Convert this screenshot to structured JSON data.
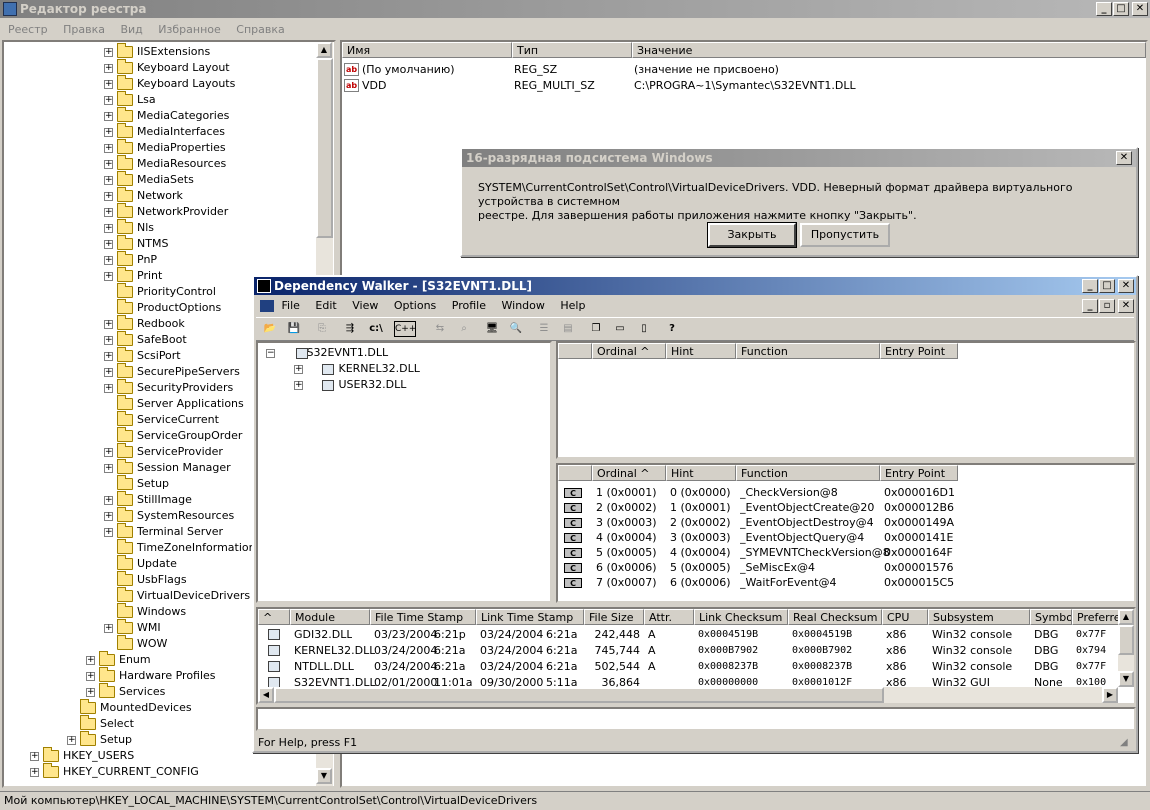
{
  "regedit": {
    "title": "Редактор реестра",
    "menu": [
      "Реестр",
      "Правка",
      "Вид",
      "Избранное",
      "Справка"
    ],
    "tree": [
      {
        "label": "IISExtensions",
        "plus": true
      },
      {
        "label": "Keyboard Layout",
        "plus": true
      },
      {
        "label": "Keyboard Layouts",
        "plus": true
      },
      {
        "label": "Lsa",
        "plus": true
      },
      {
        "label": "MediaCategories",
        "plus": true
      },
      {
        "label": "MediaInterfaces",
        "plus": true
      },
      {
        "label": "MediaProperties",
        "plus": true
      },
      {
        "label": "MediaResources",
        "plus": true
      },
      {
        "label": "MediaSets",
        "plus": true
      },
      {
        "label": "Network",
        "plus": true
      },
      {
        "label": "NetworkProvider",
        "plus": true
      },
      {
        "label": "Nls",
        "plus": true
      },
      {
        "label": "NTMS",
        "plus": true
      },
      {
        "label": "PnP",
        "plus": true
      },
      {
        "label": "Print",
        "plus": true
      },
      {
        "label": "PriorityControl",
        "plus": false
      },
      {
        "label": "ProductOptions",
        "plus": false
      },
      {
        "label": "Redbook",
        "plus": true
      },
      {
        "label": "SafeBoot",
        "plus": true
      },
      {
        "label": "ScsiPort",
        "plus": true
      },
      {
        "label": "SecurePipeServers",
        "plus": true
      },
      {
        "label": "SecurityProviders",
        "plus": true
      },
      {
        "label": "Server Applications",
        "plus": false
      },
      {
        "label": "ServiceCurrent",
        "plus": false
      },
      {
        "label": "ServiceGroupOrder",
        "plus": false
      },
      {
        "label": "ServiceProvider",
        "plus": true
      },
      {
        "label": "Session Manager",
        "plus": true
      },
      {
        "label": "Setup",
        "plus": false
      },
      {
        "label": "StillImage",
        "plus": true
      },
      {
        "label": "SystemResources",
        "plus": true
      },
      {
        "label": "Terminal Server",
        "plus": true
      },
      {
        "label": "TimeZoneInformation",
        "plus": false
      },
      {
        "label": "Update",
        "plus": false
      },
      {
        "label": "UsbFlags",
        "plus": false
      },
      {
        "label": "VirtualDeviceDrivers",
        "plus": false
      },
      {
        "label": "Windows",
        "plus": false
      },
      {
        "label": "WMI",
        "plus": true
      },
      {
        "label": "WOW",
        "plus": false
      }
    ],
    "tree_upper": [
      {
        "label": "Enum",
        "plus": true
      },
      {
        "label": "Hardware Profiles",
        "plus": true
      },
      {
        "label": "Services",
        "plus": true
      }
    ],
    "tree_root": [
      {
        "label": "MountedDevices",
        "plus": false,
        "indent": 1
      },
      {
        "label": "Select",
        "plus": false,
        "indent": 1
      },
      {
        "label": "Setup",
        "plus": true,
        "indent": 1
      },
      {
        "label": "HKEY_USERS",
        "plus": true,
        "indent": 0
      },
      {
        "label": "HKEY_CURRENT_CONFIG",
        "plus": true,
        "indent": 0
      }
    ],
    "columns": [
      "Имя",
      "Тип",
      "Значение"
    ],
    "values": [
      {
        "name": "(По умолчанию)",
        "type": "REG_SZ",
        "data": "(значение не присвоено)"
      },
      {
        "name": "VDD",
        "type": "REG_MULTI_SZ",
        "data": "C:\\PROGRA~1\\Symantec\\S32EVNT1.DLL"
      }
    ],
    "status": "Мой компьютер\\HKEY_LOCAL_MACHINE\\SYSTEM\\CurrentControlSet\\Control\\VirtualDeviceDrivers"
  },
  "dialog": {
    "title": "16-разрядная подсистема Windows",
    "line1": "SYSTEM\\CurrentControlSet\\Control\\VirtualDeviceDrivers. VDD. Неверный формат драйвера виртуального устройства в системном",
    "line2": "реестре. Для завершения работы приложения нажмите кнопку \"Закрыть\".",
    "close_label": "Закрыть",
    "skip_label": "Пропустить"
  },
  "depends": {
    "title": "Dependency Walker - [S32EVNT1.DLL]",
    "menu": [
      "File",
      "Edit",
      "View",
      "Options",
      "Profile",
      "Window",
      "Help"
    ],
    "toolbar_text": {
      "cpath": "c:\\",
      "cpp": "C++"
    },
    "tree": {
      "root": "S32EVNT1.DLL",
      "children": [
        "KERNEL32.DLL",
        "USER32.DLL"
      ]
    },
    "func_columns": [
      "Ordinal ^",
      "Hint",
      "Function",
      "Entry Point"
    ],
    "exports": [
      {
        "ord": "1 (0x0001)",
        "hint": "0 (0x0000)",
        "fn": "_CheckVersion@8",
        "ep": "0x000016D1"
      },
      {
        "ord": "2 (0x0002)",
        "hint": "1 (0x0001)",
        "fn": "_EventObjectCreate@20",
        "ep": "0x000012B6"
      },
      {
        "ord": "3 (0x0003)",
        "hint": "2 (0x0002)",
        "fn": "_EventObjectDestroy@4",
        "ep": "0x0000149A"
      },
      {
        "ord": "4 (0x0004)",
        "hint": "3 (0x0003)",
        "fn": "_EventObjectQuery@4",
        "ep": "0x0000141E"
      },
      {
        "ord": "5 (0x0005)",
        "hint": "4 (0x0004)",
        "fn": "_SYMEVNTCheckVersion@8",
        "ep": "0x0000164F"
      },
      {
        "ord": "6 (0x0006)",
        "hint": "5 (0x0005)",
        "fn": "_SeMiscEx@4",
        "ep": "0x00001576"
      },
      {
        "ord": "7 (0x0007)",
        "hint": "6 (0x0006)",
        "fn": "_WaitForEvent@4",
        "ep": "0x000015C5"
      }
    ],
    "export_icon": "C",
    "module_columns": [
      "^",
      "Module",
      "File Time Stamp",
      "Link Time Stamp",
      "File Size",
      "Attr.",
      "Link Checksum",
      "Real Checksum",
      "CPU",
      "Subsystem",
      "Symbols",
      "Preferre"
    ],
    "modules": [
      {
        "m": "GDI32.DLL",
        "fd": "03/23/2004",
        "ft": "6:21p",
        "ld": "03/24/2004",
        "lt": "6:21a",
        "size": "242,448",
        "attr": "A",
        "lc": "0x0004519B",
        "rc": "0x0004519B",
        "cpu": "x86",
        "sub": "Win32 console",
        "sym": "DBG",
        "pref": "0x77F"
      },
      {
        "m": "KERNEL32.DLL",
        "fd": "03/24/2004",
        "ft": "6:21a",
        "ld": "03/24/2004",
        "lt": "6:21a",
        "size": "745,744",
        "attr": "A",
        "lc": "0x000B7902",
        "rc": "0x000B7902",
        "cpu": "x86",
        "sub": "Win32 console",
        "sym": "DBG",
        "pref": "0x794"
      },
      {
        "m": "NTDLL.DLL",
        "fd": "03/24/2004",
        "ft": "6:21a",
        "ld": "03/24/2004",
        "lt": "6:21a",
        "size": "502,544",
        "attr": "A",
        "lc": "0x0008237B",
        "rc": "0x0008237B",
        "cpu": "x86",
        "sub": "Win32 console",
        "sym": "DBG",
        "pref": "0x77F"
      },
      {
        "m": "S32EVNT1.DLL",
        "fd": "02/01/2000",
        "ft": "11:01a",
        "ld": "09/30/2000",
        "lt": "5:11a",
        "size": "36,864",
        "attr": "",
        "lc": "0x00000000",
        "rc": "0x0001012F",
        "cpu": "x86",
        "sub": "Win32 GUI",
        "sym": "None",
        "pref": "0x100"
      }
    ],
    "status": "For Help, press F1"
  }
}
